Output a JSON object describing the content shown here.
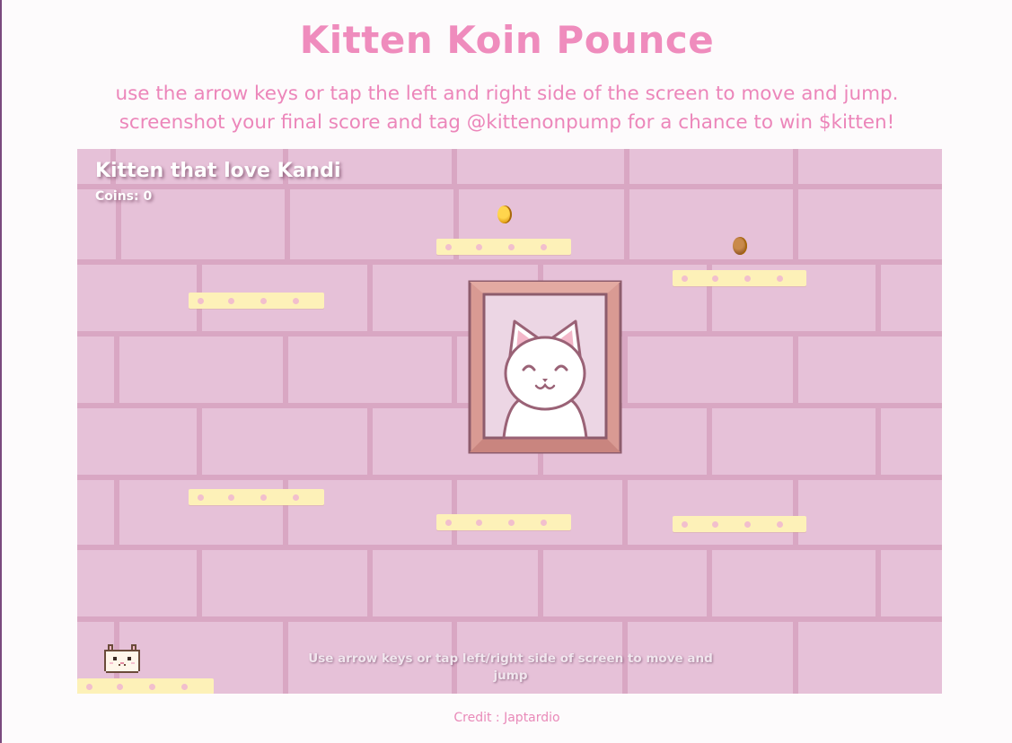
{
  "header": {
    "title": "Kitten Koin Pounce",
    "instructions_line1": "use the arrow keys or tap the left and right side of the screen to move and jump.",
    "instructions_line2": "screenshot your final score and tag @kittenonpump for a chance to win $kitten!"
  },
  "game": {
    "hud_title": "Kitten that love Kandi",
    "coins_label": "Coins:",
    "coins_value": "0",
    "hint": "Use arrow keys or tap left/right side of screen to move and jump"
  },
  "footer": {
    "credit": "Credit : Japtardio"
  },
  "colors": {
    "title": "#ef8cbd",
    "wall": "#e6c1d8",
    "brick_line": "#dcaac6",
    "platform": "#fdf1b8",
    "frame": "#d99a93"
  },
  "icons": {
    "coin": "gold-coin-icon",
    "coin_alt": "bronze-coin-icon",
    "player": "pixel-kitten",
    "painting": "cat-portrait"
  }
}
